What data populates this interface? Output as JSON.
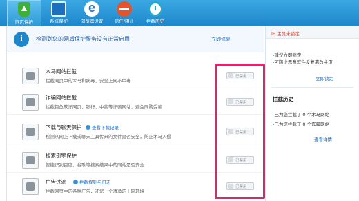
{
  "toolbar": {
    "items": [
      {
        "label": "网页保护",
        "icon": "shield-icon",
        "active": true
      },
      {
        "label": "系统保护",
        "icon": "monitor-icon",
        "active": false
      },
      {
        "label": "浏览器设置",
        "icon": "ie-icon",
        "active": false
      },
      {
        "label": "信任/阻止",
        "icon": "block-icon",
        "active": false
      },
      {
        "label": "拦截历史",
        "icon": "history-icon",
        "active": false
      }
    ],
    "colors": {
      "bar": "#1e86cb",
      "active": "#5fc1ef"
    }
  },
  "notice": {
    "text": "检测到您的网盾保护服务没有正常启用",
    "link": "立即修复"
  },
  "protections": [
    {
      "title": "木马网站拦截",
      "desc": "拦截网页中的木马和病毒，安全上网不中毒",
      "toggle": "已禁用",
      "extra_link": ""
    },
    {
      "title": "诈骗网站拦截",
      "desc": "拦截钓鱼欺诈网页、银行、中奖等诈骗网站，避免网购受骗",
      "toggle": "已禁用",
      "extra_link": ""
    },
    {
      "title": "下载与聊天保护",
      "desc": "检测从网上下载或聊天工具传来的文件是否安全，防止木马入侵",
      "toggle": "已禁用",
      "extra_link": "查看下载记录"
    },
    {
      "title": "搜索引擎保护",
      "desc": "智能识别百度、谷歌等搜索结果中的网站是否安全",
      "toggle": "已禁用",
      "extra_link": ""
    },
    {
      "title": "广告过滤",
      "desc": "拦截网页中的各种广告，还您一个清净的上网环境",
      "toggle": "已禁用",
      "extra_link": "拦截规则与日志"
    }
  ],
  "side": {
    "warning": "IE 主页未锁定",
    "lines": [
      "-建议立即锁定",
      "-可防止恶意软件反复篡改主页"
    ],
    "lock_link": "立即锁定",
    "history_title": "拦截历史",
    "history_lines": [
      "-已为您拦截了 0 个木马网站",
      "-已为您拦截了 0 个诈骗网站"
    ],
    "details_link": "查看详情"
  },
  "accent": "#e0256f"
}
